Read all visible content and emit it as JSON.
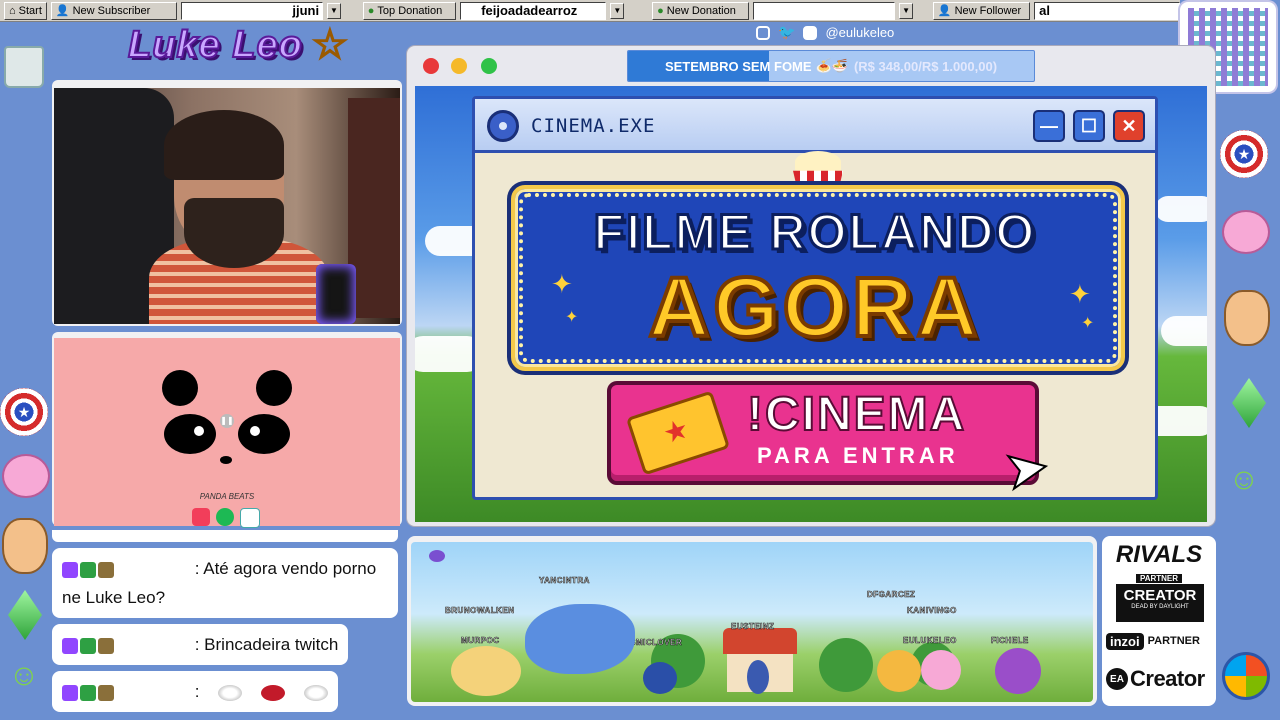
{
  "taskbar": {
    "start_label": "Start",
    "new_subscriber_label": "New Subscriber",
    "subscriber_value": "jjuni",
    "top_donation_label": "Top Donation",
    "top_donation_value": "feijoadadearroz",
    "new_donation_label": "New Donation",
    "new_follower_label": "New Follower",
    "follower_value": "al"
  },
  "branding": {
    "logo_text": "Luke Leo",
    "social_handle": "@eulukeleo",
    "social_icons": [
      "instagram-icon",
      "twitter-icon",
      "youtube-icon"
    ]
  },
  "goal": {
    "title": "SETEMBRO SEM FOME",
    "emoji": "🍝🍜",
    "amount": "(R$ 348,00/R$ 1.000,00)",
    "progress": 0.348
  },
  "music": {
    "title": "PANDA BEATS",
    "icons": [
      "apple-music-icon",
      "spotify-icon",
      "amazon-music-icon"
    ]
  },
  "chat": {
    "messages": [
      {
        "text": ": Até agora vendo porno ne Luke Leo?"
      },
      {
        "text": ": Brincadeira twitch"
      },
      {
        "text": ":",
        "emotes": [
          "egg-emote",
          "lips-emote",
          "egg-emote"
        ]
      }
    ]
  },
  "window": {
    "title": "CINEMA.EXE",
    "minimize": "—",
    "maximize": "☐",
    "close": "✕"
  },
  "cinema": {
    "line1": "FILME ROLANDO",
    "line2": "AGORA",
    "cta_main": "!CINEMA",
    "cta_sub": "PARA ENTRAR"
  },
  "chatters": [
    "YANCINTRA",
    "BRUNOWALKEN",
    "MURPOC",
    "EUCOSMICLOVER",
    "EUSTEINZ",
    "DFGARCEZ",
    "KANIVINGO",
    "EULUKELEO",
    "FICHELE"
  ],
  "partners": {
    "rivals": "RIVALS",
    "rivals_sub": "PARTNER",
    "creator": "CREATOR",
    "creator_sub": "DEAD BY DAYLIGHT",
    "inzoi": "inzoi",
    "inzoi_sub": "PARTNER",
    "ea": "Creator"
  },
  "colors": {
    "background": "#6b8fd1",
    "accent_blue": "#2f7ad6",
    "cta_pink": "#e9338f",
    "marquee_yellow": "#ffc928"
  }
}
